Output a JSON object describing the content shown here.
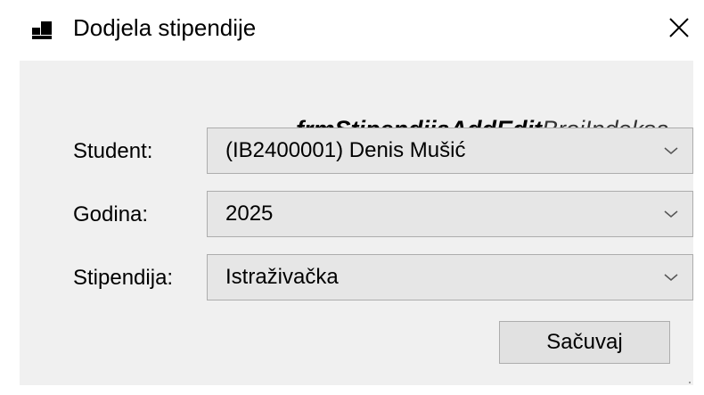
{
  "window": {
    "title": "Dodjela stipendije",
    "icon": "app-window-icon",
    "close_icon": "close-icon"
  },
  "form_label": {
    "bold_part": "frmStipendijaAddEdit",
    "suffix": "BrojIndeksa"
  },
  "fields": {
    "student": {
      "label": "Student:",
      "value": "(IB2400001) Denis Mušić"
    },
    "godina": {
      "label": "Godina:",
      "value": "2025"
    },
    "stipendija": {
      "label": "Stipendija:",
      "value": "Istraživačka"
    }
  },
  "buttons": {
    "save_label": "Sačuvaj"
  },
  "colors": {
    "client_bg": "#f0f0f0",
    "combo_bg": "#e6e6e6",
    "button_bg": "#e1e1e1",
    "border": "#adadad"
  }
}
